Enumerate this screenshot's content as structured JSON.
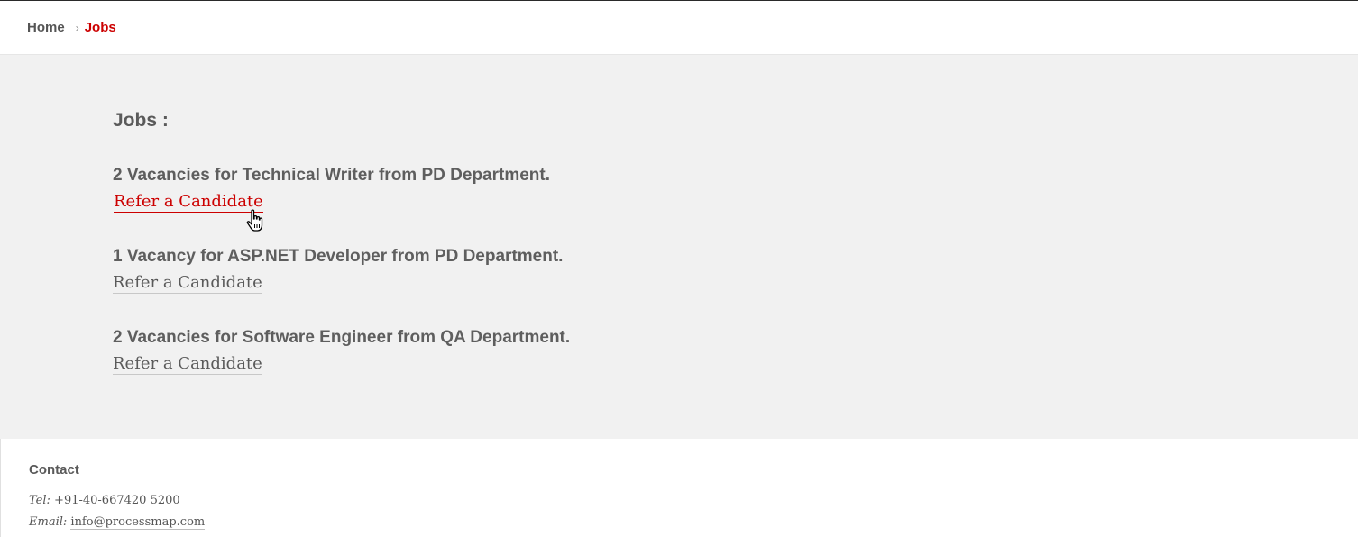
{
  "breadcrumb": {
    "home": "Home",
    "separator": "›",
    "current": "Jobs"
  },
  "main": {
    "heading": "Jobs :",
    "jobs": [
      {
        "title": "2 Vacancies for Technical Writer from PD Department.",
        "link": "Refer a Candidate",
        "state": "hover"
      },
      {
        "title": "1 Vacancy for ASP.NET Developer from PD Department.",
        "link": "Refer a Candidate",
        "state": "normal"
      },
      {
        "title": "2 Vacancies for Software Engineer from QA Department.",
        "link": "Refer a Candidate",
        "state": "normal"
      }
    ]
  },
  "footer": {
    "heading": "Contact",
    "tel_label": "Tel:",
    "tel_value": "+91-40-667420 5200",
    "email_label": "Email:",
    "email_value": "info@processmap.com"
  },
  "colors": {
    "accent": "#cc0000",
    "text": "#5a5a5a",
    "content_bg": "#f1f1f1"
  },
  "icons": {
    "cursor": "hand-pointer-icon"
  }
}
